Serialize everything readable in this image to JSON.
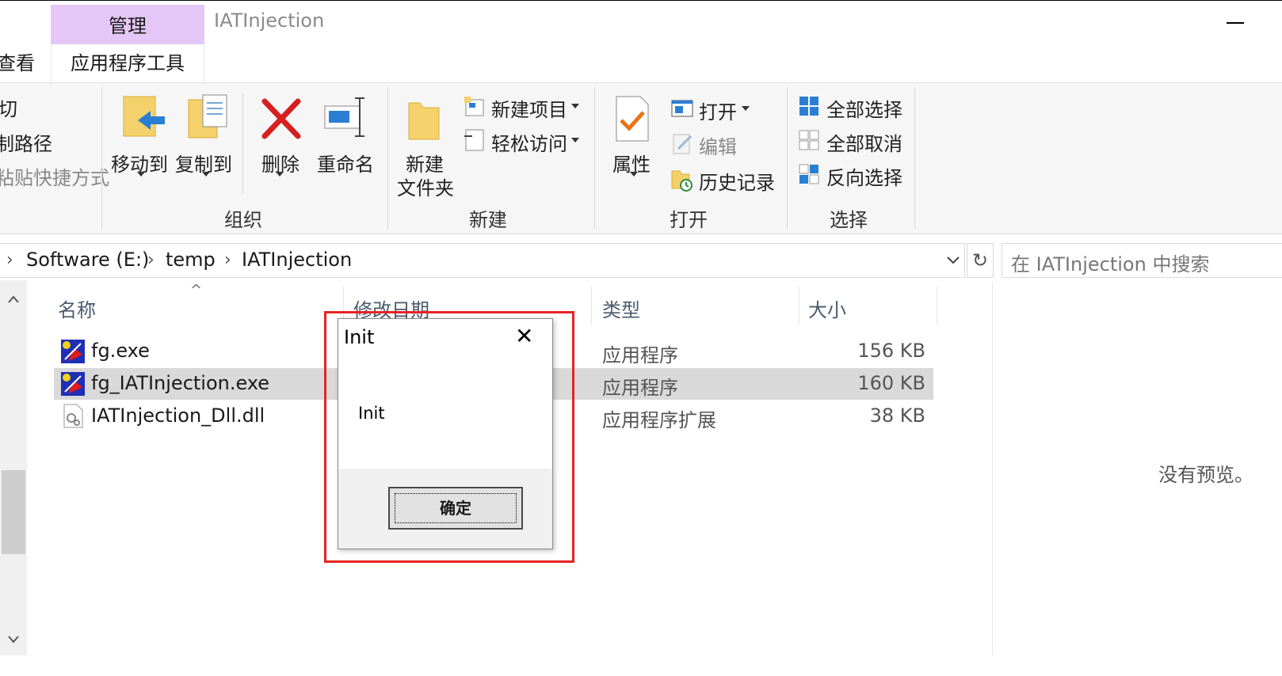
{
  "window": {
    "title": "IATInjection"
  },
  "tabs": {
    "context_group": "管理",
    "context_tab": "应用程序工具",
    "view_tab": "查看"
  },
  "ribbon": {
    "clipboard_partial": {
      "cut": "切",
      "copy_path": "制路径",
      "paste_shortcut": "粘贴快捷方式"
    },
    "organize": {
      "move_to": "移动到",
      "copy_to": "复制到",
      "delete": "删除",
      "rename": "重命名",
      "label": "组织"
    },
    "new": {
      "new_folder_line1": "新建",
      "new_folder_line2": "文件夹",
      "new_item": "新建项目",
      "easy_access": "轻松访问",
      "label": "新建"
    },
    "open": {
      "properties": "属性",
      "open": "打开",
      "edit": "编辑",
      "history": "历史记录",
      "label": "打开"
    },
    "select": {
      "select_all": "全部选择",
      "select_none": "全部取消",
      "invert_selection": "反向选择",
      "label": "选择"
    }
  },
  "address": {
    "crumbs": [
      "Software (E:)",
      "temp",
      "IATInjection"
    ],
    "search_placeholder": "在 IATInjection 中搜索"
  },
  "columns": {
    "name": "名称",
    "modified": "修改日期",
    "type": "类型",
    "size": "大小"
  },
  "files": [
    {
      "name": "fg.exe",
      "type": "应用程序",
      "size": "156 KB",
      "icon": "app-exe-icon"
    },
    {
      "name": "fg_IATInjection.exe",
      "type": "应用程序",
      "size": "160 KB",
      "icon": "app-exe-icon"
    },
    {
      "name": "IATInjection_Dll.dll",
      "type": "应用程序扩展",
      "size": "38 KB",
      "icon": "dll-file-icon"
    }
  ],
  "preview": {
    "empty_text": "没有预览。"
  },
  "dialog": {
    "title": "Init",
    "message": "Init",
    "ok_label": "确定",
    "close_glyph": "✕"
  },
  "colors": {
    "context_tab": "#e5c7f7",
    "selection": "#d9d9d9",
    "highlight_border": "#e52424",
    "ribbon_bg": "#f6f6f6"
  }
}
